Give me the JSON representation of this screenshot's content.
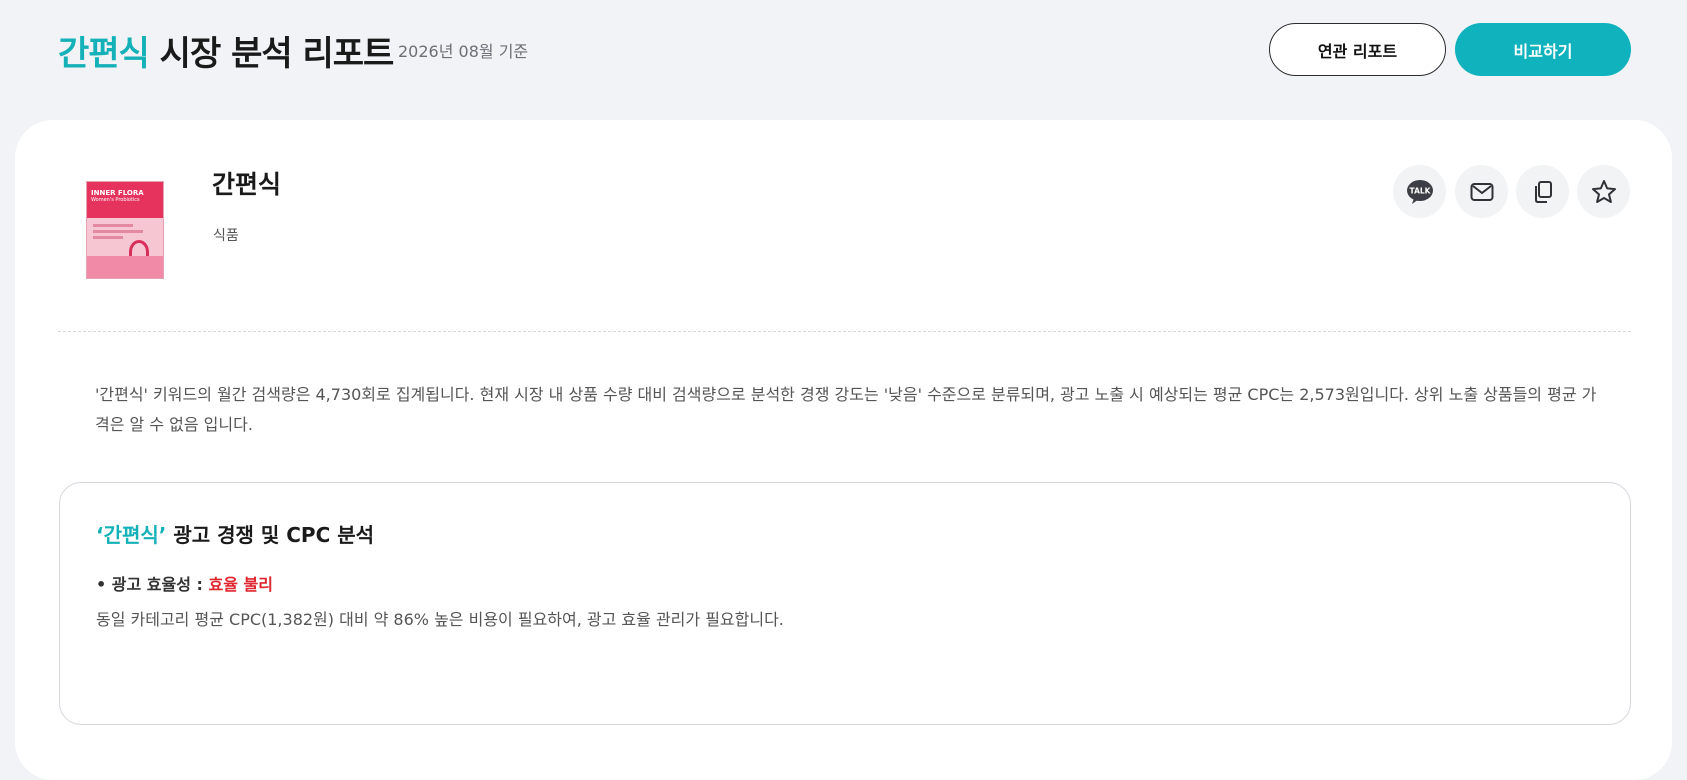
{
  "header": {
    "title_keyword": "간편식",
    "title_rest": " 시장 분석 리포트",
    "date": "2026년 08월 기준",
    "related_button": "연관 리포트",
    "compare_button": "비교하기"
  },
  "product": {
    "name": "간편식",
    "category": "식품",
    "image_brand": "INNER FLORA",
    "image_subtitle": "Women's Probiotics"
  },
  "share": {
    "talk_label": "TALK",
    "icons": [
      "kakao-talk-icon",
      "mail-icon",
      "copy-icon",
      "star-icon"
    ]
  },
  "summary": {
    "text": "'간편식' 키워드의 월간 검색량은 4,730회로 집계됩니다. 현재 시장 내 상품 수량 대비 검색량으로 분석한 경쟁 강도는 '낮음' 수준으로 분류되며, 광고 노출 시 예상되는 평균 CPC는 2,573원입니다. 상위 노출 상품들의 평균 가격은 알 수 없음 입니다."
  },
  "analysis": {
    "title_keyword": "‘간편식’",
    "title_rest": " 광고 경쟁 및 CPC 분석",
    "efficiency_label": "• 광고 효율성 : ",
    "efficiency_value": "효율 불리",
    "description": "동일 카테고리 평균 CPC(1,382원) 대비 약 86% 높은 비용이 필요하여, 광고 효율 관리가 필요합니다."
  },
  "colors": {
    "accent": "#15b1b8",
    "compare_button": "#10b3bd",
    "negative": "#e0262f"
  }
}
